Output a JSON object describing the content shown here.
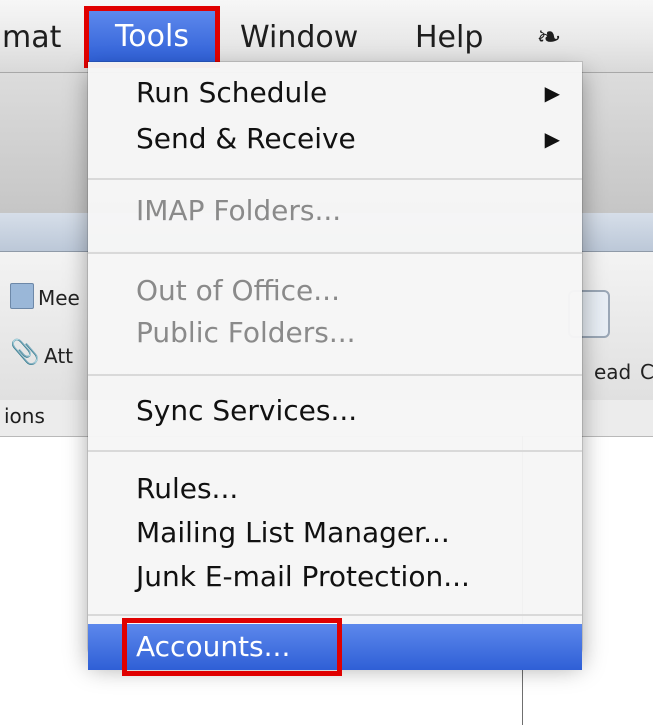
{
  "menubar": {
    "format": "mat",
    "tools": "Tools",
    "window": "Window",
    "help": "Help",
    "script_icon": "script-menu-icon"
  },
  "background": {
    "meeting": "Mee",
    "attach": "Att",
    "read": "ead",
    "edge": "C",
    "options": "ions"
  },
  "menu": {
    "run_schedule": "Run Schedule",
    "send_receive": "Send & Receive",
    "imap_folders": "IMAP Folders...",
    "out_of_office": "Out of Office...",
    "public_folders": "Public Folders...",
    "sync_services": "Sync Services...",
    "rules": "Rules...",
    "mailing_list_manager": "Mailing List Manager...",
    "junk_protection": "Junk E-mail Protection...",
    "accounts": "Accounts...",
    "submenu_arrow": "▶"
  },
  "colors": {
    "highlight": "#3a6ade",
    "annotation": "#e00000",
    "disabled_text": "#8a8a8a"
  }
}
